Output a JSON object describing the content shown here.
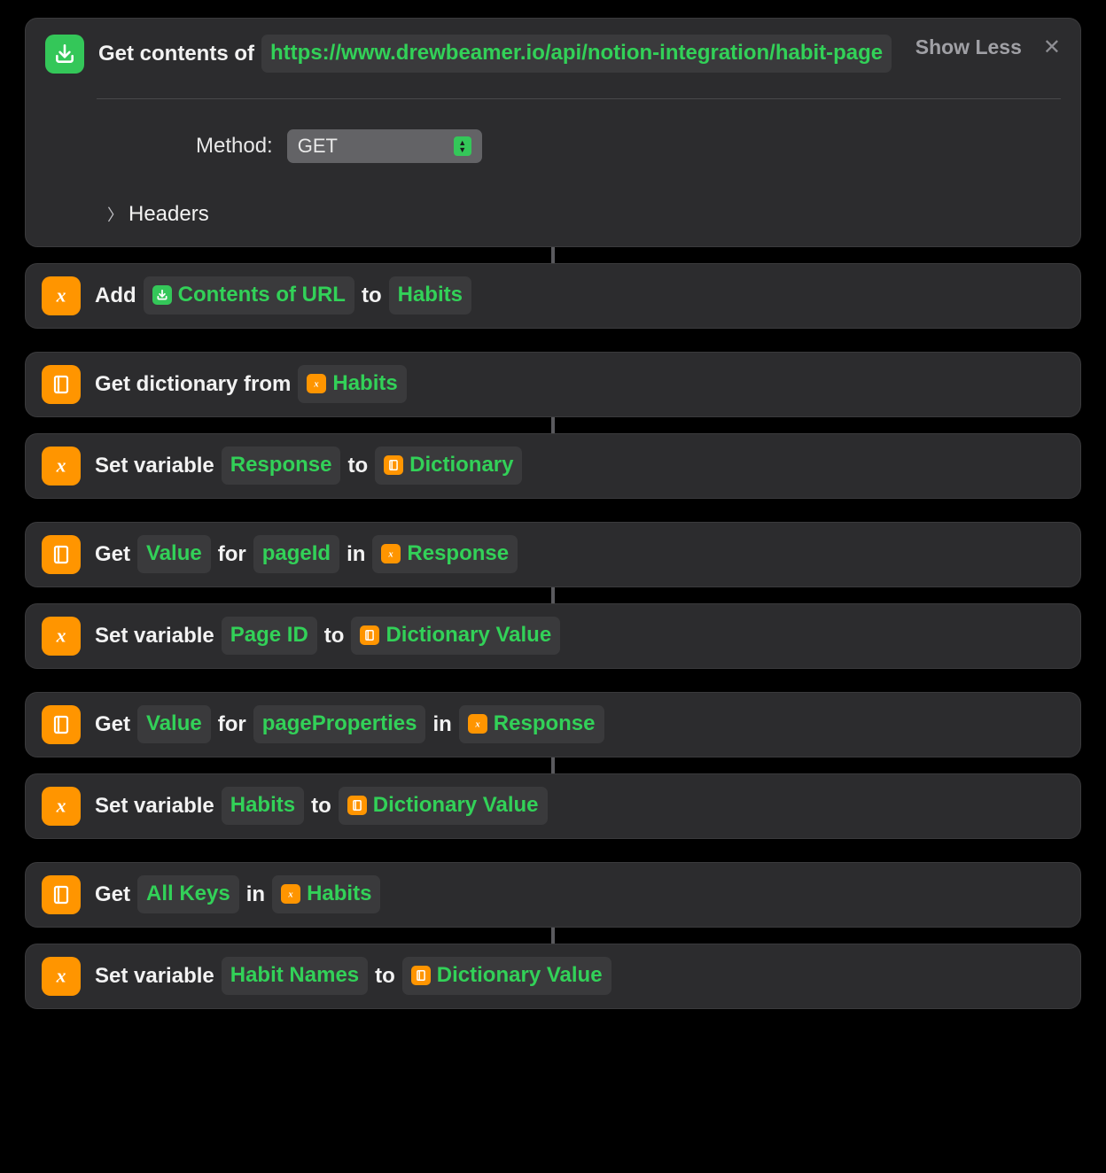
{
  "actions": {
    "get_contents": {
      "prefix": "Get contents of",
      "url": "https://www.drewbeamer.io/api/notion-integration/habit-page",
      "show_less": "Show Less",
      "method_label": "Method:",
      "method_value": "GET",
      "headers_label": "Headers"
    },
    "add": {
      "word_add": "Add",
      "token_contents": "Contents of URL",
      "word_to": "to",
      "token_habits": "Habits"
    },
    "get_dict": {
      "prefix": "Get dictionary from",
      "token_habits": "Habits"
    },
    "set_response": {
      "prefix": "Set variable",
      "token_response": "Response",
      "word_to": "to",
      "token_dict": "Dictionary"
    },
    "get_pageid": {
      "word_get": "Get",
      "token_value": "Value",
      "word_for": "for",
      "token_pageid": "pageId",
      "word_in": "in",
      "token_response": "Response"
    },
    "set_pageid": {
      "prefix": "Set variable",
      "token_pageid": "Page ID",
      "word_to": "to",
      "token_dictval": "Dictionary Value"
    },
    "get_pageprops": {
      "word_get": "Get",
      "token_value": "Value",
      "word_for": "for",
      "token_pageprops": "pageProperties",
      "word_in": "in",
      "token_response": "Response"
    },
    "set_habits2": {
      "prefix": "Set variable",
      "token_habits": "Habits",
      "word_to": "to",
      "token_dictval": "Dictionary Value"
    },
    "get_allkeys": {
      "word_get": "Get",
      "token_allkeys": "All Keys",
      "word_in": "in",
      "token_habits": "Habits"
    },
    "set_habitnames": {
      "prefix": "Set variable",
      "token_habitnames": "Habit Names",
      "word_to": "to",
      "token_dictval": "Dictionary Value"
    }
  }
}
